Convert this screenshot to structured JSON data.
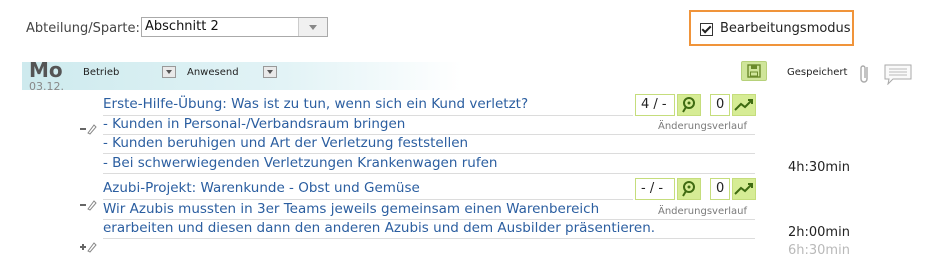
{
  "filter": {
    "label": "Abteilung/Sparte:",
    "value": "Abschnitt 2"
  },
  "edit_mode": {
    "label": "Bearbeitungsmodus",
    "checked": true
  },
  "day": {
    "name": "Mo",
    "date": "03.12."
  },
  "columns": {
    "betrieb": "Betrieb",
    "anwesend": "Anwesend"
  },
  "status": {
    "saved_label": "Gespeichert"
  },
  "entries": [
    {
      "title": "Erste-Hilfe-Übung: Was ist zu tun, wenn sich ein Kund verletzt?",
      "lines": [
        "- Kunden in Personal-/Verbandsraum bringen",
        "- Kunden beruhigen und Art der Verletzung feststellen",
        "- Bei schwerwiegenden Verletzungen Krankenwagen rufen"
      ],
      "score": "4 / -",
      "count": "0",
      "history_label": "Änderungsverlauf",
      "duration": "4h:30min"
    },
    {
      "title": "Azubi-Projekt: Warenkunde -  Obst und Gemüse",
      "lines": [
        "Wir Azubis mussten in 3er Teams jeweils gemeinsam einen Warenbereich",
        "erarbeiten und diesen dann den anderen Azubis und dem Ausbilder präsentieren."
      ],
      "score": "- / -",
      "count": "0",
      "history_label": "Änderungsverlauf",
      "duration": "2h:00min"
    }
  ],
  "total_duration": "6h:30min",
  "colors": {
    "accent_orange": "#f0943a",
    "link_blue": "#2b5ea0",
    "green": "#d6ec95"
  },
  "icons": [
    "checkbox-icon",
    "save-icon",
    "attachment-icon",
    "comment-icon",
    "pin-icon",
    "trend-icon",
    "edit-line-icon",
    "add-line-icon"
  ]
}
